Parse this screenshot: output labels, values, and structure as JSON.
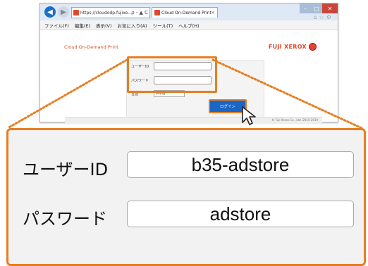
{
  "browser": {
    "url": "https://cloudodp.fujixe...",
    "address_controls": "ρ - ▲ C",
    "tab_title": "Cloud On-Demand Print",
    "tab_close": "×",
    "menu": [
      "ファイル(F)",
      "編集(E)",
      "表示(V)",
      "お気に入り(A)",
      "ツール(T)",
      "ヘルプ(H)"
    ]
  },
  "app": {
    "title": "Cloud On-Demand Print",
    "brand": "FUJI XEROX"
  },
  "login_form": {
    "user_id_label": "ユーザーID",
    "password_label": "パスワード",
    "language_label": "言語",
    "language_value": "日本語",
    "login_button": "ログイン",
    "copyright": "© Fuji Xerox Co., Ltd. 2015-2019"
  },
  "zoom": {
    "user_id_label": "ユーザーID",
    "user_id_value": "b35-adstore",
    "password_label": "パスワード",
    "password_value": "adstore"
  },
  "colors": {
    "highlight": "#e67e22",
    "brand": "#e0482a",
    "button": "#1a66c7"
  }
}
